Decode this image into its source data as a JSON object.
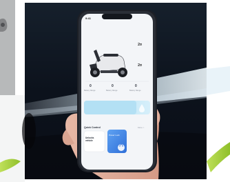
{
  "phone": {
    "status_time": "9:41",
    "stats": [
      {
        "value": "0",
        "label": "Battery Range"
      },
      {
        "value": "0",
        "label": "Battery Range"
      },
      {
        "value": "0",
        "label": "Battery Range"
      }
    ],
    "side_values": [
      "2¤",
      "2¤"
    ],
    "quick_control": {
      "title": "Quick Control",
      "link": "More >",
      "card_label": "Unlocks vehicle",
      "lock_label": "Power Lock"
    }
  },
  "colors": {
    "dark_bg": "#0e1420",
    "light_beam": "#cfe6f5",
    "accent_blue": "#bfe4f6",
    "lock_blue": "#3d7fe6",
    "green_swoosh": "#a6cf3a",
    "phone_frame": "#1c1f26"
  }
}
